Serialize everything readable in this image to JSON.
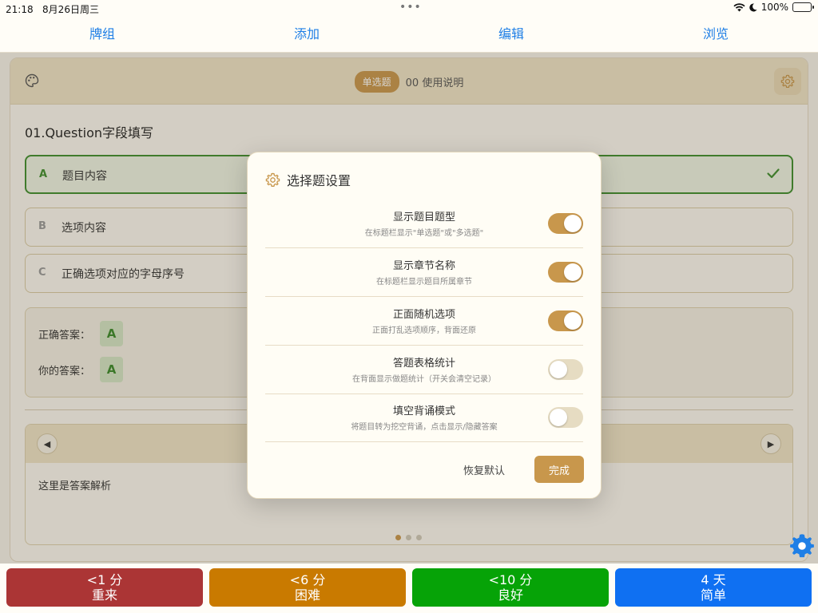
{
  "status": {
    "time": "21:18",
    "date": "8月26日周三",
    "battery": "100%"
  },
  "nav": {
    "tabs": [
      "牌组",
      "添加",
      "编辑",
      "浏览"
    ]
  },
  "header": {
    "badge": "单选题",
    "chapter": "00 使用说明"
  },
  "question": {
    "title": "01.Question字段填写",
    "options": [
      {
        "letter": "A",
        "text": "题目内容"
      },
      {
        "letter": "B",
        "text": "选项内容"
      },
      {
        "letter": "C",
        "text": "正确选项对应的字母序号"
      }
    ]
  },
  "answers": {
    "correct_label": "正确答案：",
    "correct_value": "A",
    "yours_label": "你的答案：",
    "yours_value": "A"
  },
  "analysis": {
    "text": "这里是答案解析"
  },
  "modal": {
    "title": "选择题设置",
    "settings": [
      {
        "label": "显示题目题型",
        "desc": "在标题栏显示\"单选题\"或\"多选题\"",
        "on": true
      },
      {
        "label": "显示章节名称",
        "desc": "在标题栏显示题目所属章节",
        "on": true
      },
      {
        "label": "正面随机选项",
        "desc": "正面打乱选项顺序，背面还原",
        "on": true
      },
      {
        "label": "答题表格统计",
        "desc": "在背面显示做题统计（开关会清空记录）",
        "on": false
      },
      {
        "label": "填空背诵模式",
        "desc": "将题目转为挖空背诵，点击显示/隐藏答案",
        "on": false
      }
    ],
    "reset_label": "恢复默认",
    "done_label": "完成"
  },
  "ratings": [
    {
      "time": "<1 分",
      "label": "重来",
      "color": "#ab3535"
    },
    {
      "time": "<6 分",
      "label": "困难",
      "color": "#c97a00"
    },
    {
      "time": "<10 分",
      "label": "良好",
      "color": "#06a307"
    },
    {
      "time": "4 天",
      "label": "简单",
      "color": "#0f70f2"
    }
  ],
  "colors": {
    "accent": "#c8974c",
    "correct": "#3f8e2e",
    "link": "#1f7fe6"
  }
}
